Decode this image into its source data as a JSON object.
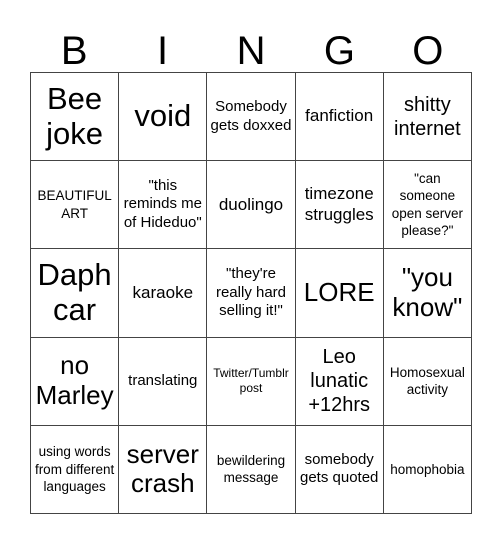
{
  "header": {
    "letters": [
      "B",
      "I",
      "N",
      "G",
      "O"
    ]
  },
  "grid": {
    "rows": [
      [
        "Bee joke",
        "void",
        "Somebody gets doxxed",
        "fanfiction",
        "shitty internet"
      ],
      [
        "BEAUTIFUL ART",
        "\"this reminds me of Hideduo\"",
        "duolingo",
        "timezone struggles",
        "\"can someone open server please?\""
      ],
      [
        "Daph car",
        "karaoke",
        "\"they're really hard selling it!\"",
        "LORE",
        "\"you know\""
      ],
      [
        "no Marley",
        "translating",
        "Twitter/Tumblr post",
        "Leo lunatic +12hrs",
        "Homosexual activity"
      ],
      [
        "using words from different languages",
        "server crash",
        "bewildering message",
        "somebody gets quoted",
        "homophobia"
      ]
    ]
  }
}
